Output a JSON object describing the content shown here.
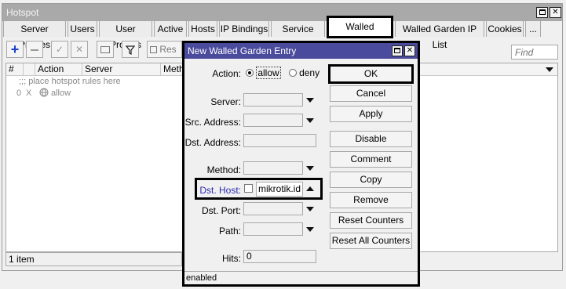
{
  "window": {
    "title": "Hotspot"
  },
  "tabs": [
    {
      "label": "Server Profiles"
    },
    {
      "label": "Users"
    },
    {
      "label": "User Profiles"
    },
    {
      "label": "Active"
    },
    {
      "label": "Hosts"
    },
    {
      "label": "IP Bindings"
    },
    {
      "label": "Service Ports"
    },
    {
      "label": "Walled Garden"
    },
    {
      "label": "Walled Garden IP List"
    },
    {
      "label": "Cookies"
    },
    {
      "label": "..."
    }
  ],
  "toolbar": {
    "reset_partial": "Res",
    "find_placeholder": "Find"
  },
  "table": {
    "headers": [
      "#",
      "Action",
      "Server",
      "Meth"
    ],
    "placeholder_row": ";;; place hotspot rules here",
    "rows": [
      {
        "index": "0",
        "flag": "X",
        "action": "allow"
      }
    ]
  },
  "status_bar": {
    "count": "1 item"
  },
  "dialog": {
    "title": "New Walled Garden Entry",
    "labels": {
      "action": "Action:",
      "server": "Server:",
      "src_address": "Src. Address:",
      "dst_address": "Dst. Address:",
      "method": "Method:",
      "dst_host": "Dst. Host:",
      "dst_port": "Dst. Port:",
      "path": "Path:",
      "hits": "Hits:"
    },
    "action_options": {
      "allow": "allow",
      "deny": "deny",
      "selected": "allow"
    },
    "dst_host_value": "mikrotik.id",
    "hits_value": "0",
    "buttons": {
      "ok": "OK",
      "cancel": "Cancel",
      "apply": "Apply",
      "disable": "Disable",
      "comment": "Comment",
      "copy": "Copy",
      "remove": "Remove",
      "reset_counters": "Reset Counters",
      "reset_all_counters": "Reset All Counters"
    },
    "status": "enabled"
  },
  "colors": {
    "dialog_title_bg": "#4b4b9e",
    "main_title_bg": "#a9a9a9",
    "dst_host_label": "#2a2ab0",
    "add_icon": "#1a3fc9"
  }
}
